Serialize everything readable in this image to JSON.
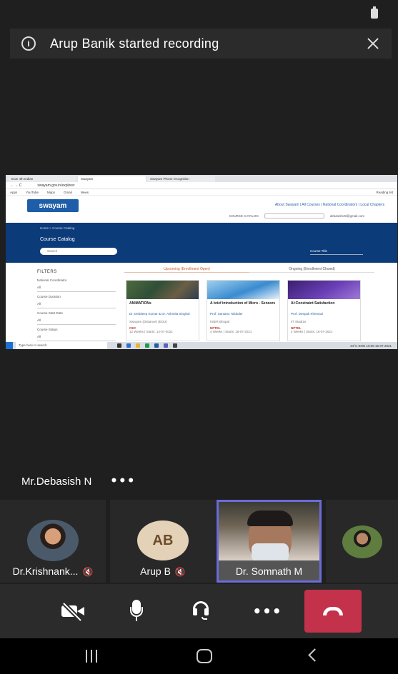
{
  "banner": {
    "text": "Arup Banik started recording",
    "info_icon": "info-icon",
    "close_icon": "close-icon"
  },
  "shared_screen": {
    "tabs": [
      "ECE 4th Indian",
      "Swayam",
      "Swayam Phone recognition"
    ],
    "url": "swayam.gov.in/explorer",
    "bookmarks": [
      "Apps",
      "YouTube",
      "Maps",
      "Gmail",
      "News"
    ],
    "bookmarks_right": "Reading list",
    "logo": "swayam",
    "nav_links": "About Swayam | All Courses | National Coordinators | Local Chapters",
    "course_catalog_menu": "COURSE CATALOG",
    "user_email": "debasish49@gmail.com",
    "breadcrumb": "Home > Course Catalog",
    "page_title": "Course Catalog",
    "search_placeholder": "Search",
    "sort_label": "Course Title",
    "filters": {
      "heading": "FILTERS",
      "items": [
        {
          "label": "National Coordinator",
          "value": "All"
        },
        {
          "label": "Course Duration",
          "value": "All"
        },
        {
          "label": "Course Start Date",
          "value": "All"
        },
        {
          "label": "Course Status",
          "value": "All"
        }
      ]
    },
    "subtabs": [
      "Upcoming (Enrollment Open)",
      "Ongoing (Enrollment Closed)"
    ],
    "cards": [
      {
        "title": "ANIMATIONs",
        "profs": "Dr. Debdeep Kumar & Dr. Ashmita Singhal",
        "subtitle": "Swayam (Distance) (EDU)",
        "badge": "CEC",
        "weeks": "12 Weeks | Starts: 14-07-2021"
      },
      {
        "title": "A brief introduction of Micro - Sensors",
        "profs": "Prof. Santanu Talukder",
        "subtitle": "IISER Bhopal",
        "badge": "NPTEL",
        "weeks": "4 Weeks | Starts: 16-07-2021"
      },
      {
        "title": "AI:Constraint Satisfaction",
        "profs": "Prof. Deepak Khemani",
        "subtitle": "IIT Madras",
        "badge": "NPTEL",
        "weeks": "4 Weeks | Starts: 16-07-2021"
      }
    ],
    "taskbar": {
      "search_placeholder": "Type here to search",
      "tray": "34°C  ENG  10:09  15-07-2021"
    }
  },
  "active_speaker_label": "Mr.Debasish N",
  "more_label": "•••",
  "participants": [
    {
      "name": "Dr.Krishnank...",
      "initials": ""
    },
    {
      "name": "Arup B",
      "initials": "AB"
    },
    {
      "name": "Dr. Somnath M",
      "initials": ""
    },
    {
      "name": "",
      "initials": ""
    }
  ],
  "controls": {
    "camera": "camera-off-icon",
    "mic": "microphone-icon",
    "audio": "headset-icon",
    "more": "•••",
    "hangup": "hang-up-icon"
  },
  "colors": {
    "speaker_border": "#6b6bdc",
    "hangup": "#c4314b",
    "swayam_band": "#0c3b7a"
  }
}
